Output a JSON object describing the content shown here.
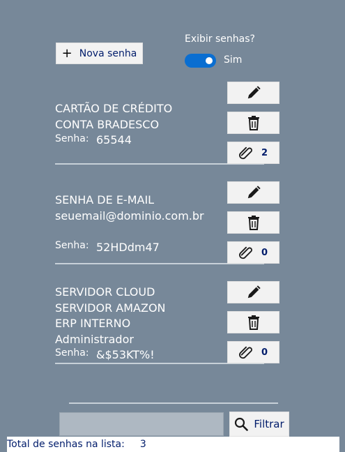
{
  "toolbar": {
    "new_password_label": "Nova senha"
  },
  "show_passwords": {
    "label": "Exibir senhas?",
    "state_text": "Sim",
    "enabled": true
  },
  "password_label": "Senha:",
  "entries": [
    {
      "lines": [
        "CARTÃO DE CRÉDITO",
        "CONTA BRADESCO"
      ],
      "password": "65544",
      "attachments": "2"
    },
    {
      "lines": [
        "SENHA DE E-MAIL",
        "seuemail@dominio.com.br"
      ],
      "password": "52HDdm47",
      "attachments": "0"
    },
    {
      "lines": [
        "SERVIDOR CLOUD",
        "SERVIDOR AMAZON",
        "ERP INTERNO",
        "Administrador"
      ],
      "password": "&$53KT%!",
      "attachments": "0"
    }
  ],
  "filter": {
    "button_label": "Filtrar",
    "value": ""
  },
  "status": {
    "label": "Total de senhas na lista:",
    "count": "3"
  },
  "colors": {
    "background": "#778899",
    "accent": "#0a6ed1",
    "dark_text": "#001c6b"
  },
  "icons": [
    "plus-icon",
    "pencil-icon",
    "trash-icon",
    "paperclip-icon",
    "search-icon"
  ]
}
